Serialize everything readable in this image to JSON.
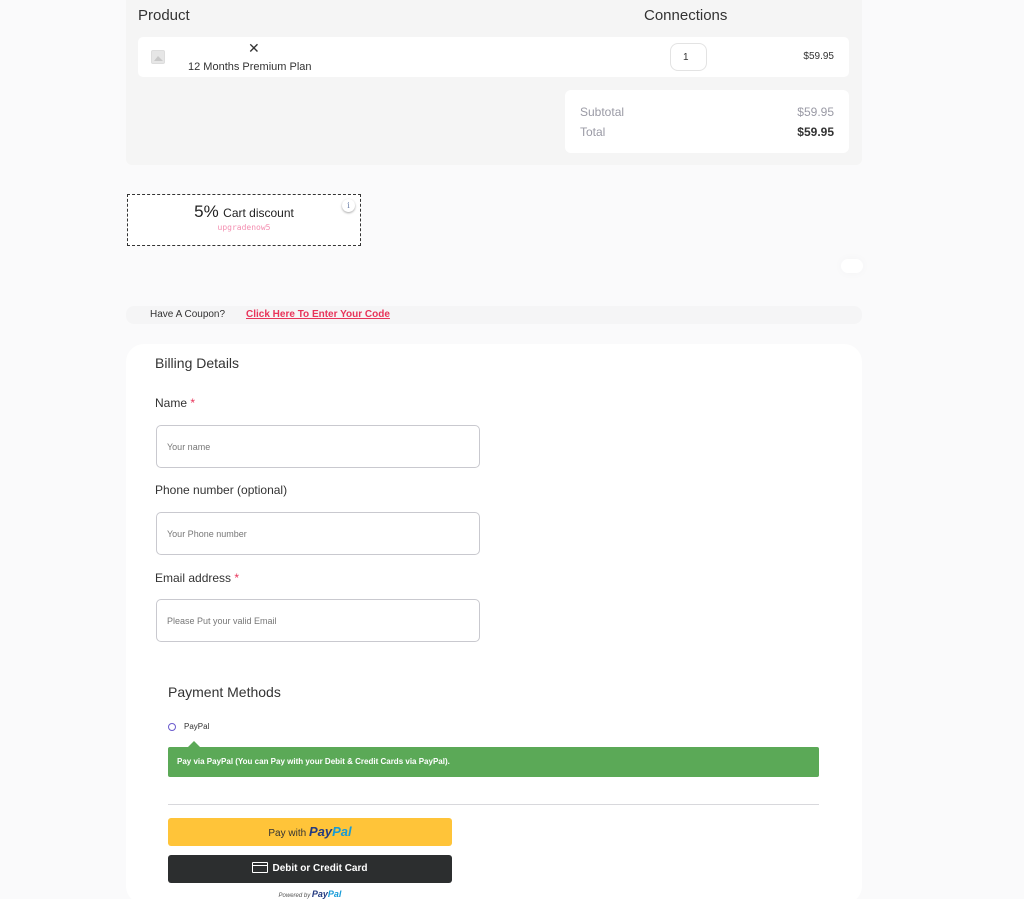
{
  "cart": {
    "header_product": "Product",
    "header_connections": "Connections",
    "items": [
      {
        "name": "12 Months Premium Plan",
        "remove_icon": "close-icon",
        "thumbnail_icon": "image-placeholder-icon",
        "quantity": "1",
        "price": "$59.95"
      }
    ],
    "subtotal_label": "Subtotal",
    "subtotal_value": "$59.95",
    "total_label": "Total",
    "total_value": "$59.95"
  },
  "discount": {
    "percent": "5%",
    "label": "Cart discount",
    "code": "upgradenow5",
    "info_icon": "i"
  },
  "coupon": {
    "question": "Have A Coupon?",
    "link": "Click Here To Enter Your Code"
  },
  "billing": {
    "title": "Billing Details",
    "fields": [
      {
        "label": "Name",
        "required": "*",
        "placeholder": "Your name",
        "value": ""
      },
      {
        "label": "Phone number (optional)",
        "required": "",
        "placeholder": "Your Phone number",
        "value": ""
      },
      {
        "label": "Email address",
        "required": "*",
        "placeholder": "Please Put your valid Email",
        "value": ""
      }
    ]
  },
  "payment": {
    "title": "Payment Methods",
    "methods": [
      {
        "label": "PayPal",
        "selected": false
      }
    ],
    "info": "Pay via PayPal (You can Pay with your Debit & Credit Cards via PayPal).",
    "paypal_button_prefix": "Pay with",
    "paypal_brand_a": "Pay",
    "paypal_brand_b": "Pal",
    "card_button": "Debit or Credit Card",
    "powered_by": "Powered by"
  },
  "colors": {
    "accent_pink": "#e8345a",
    "paypal_yellow": "#ffc439",
    "card_dark": "#2c2e2f",
    "info_green": "#5ba957"
  }
}
